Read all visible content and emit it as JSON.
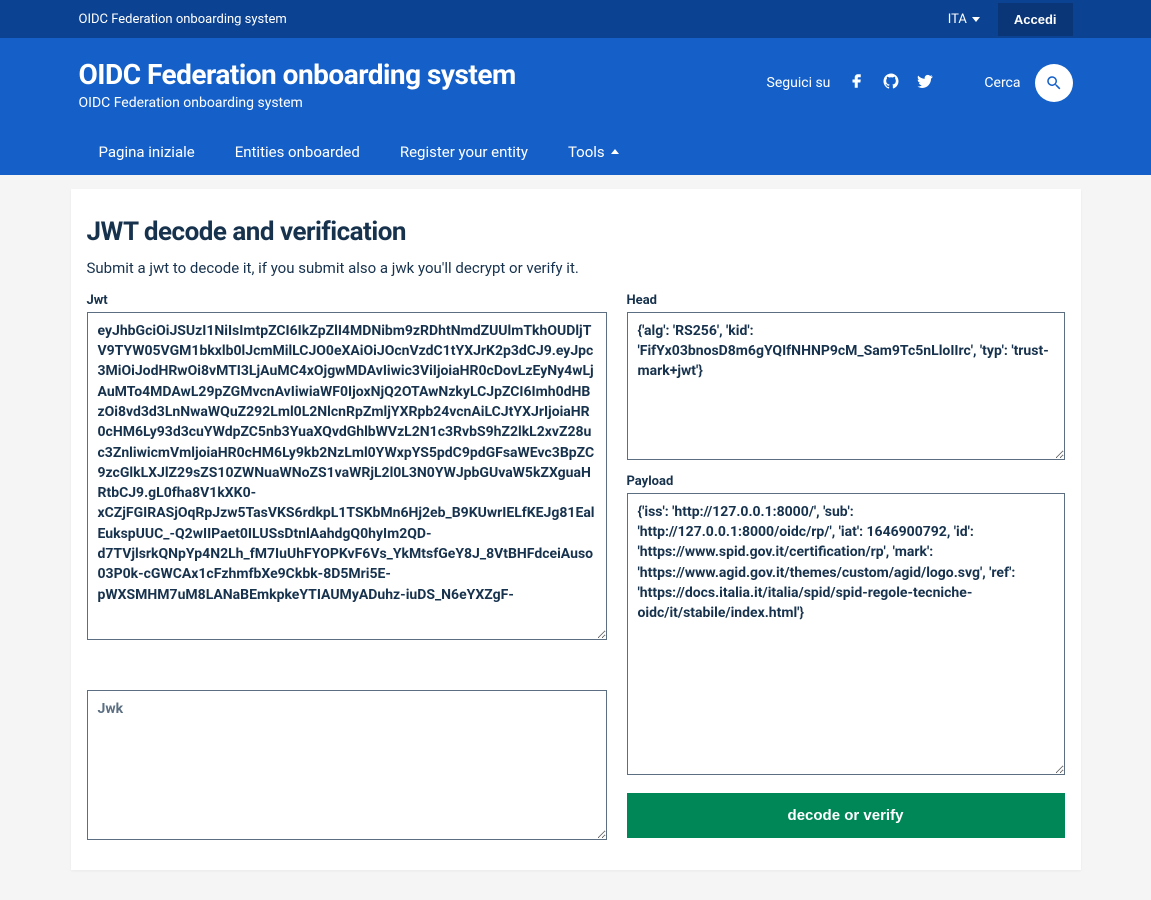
{
  "topbar": {
    "site_name": "OIDC Federation onboarding system",
    "language": "ITA",
    "login": "Accedi"
  },
  "header": {
    "title": "OIDC Federation onboarding system",
    "subtitle": "OIDC Federation onboarding system",
    "follow": "Seguici su",
    "search": "Cerca"
  },
  "nav": {
    "home": "Pagina iniziale",
    "entities": "Entities onboarded",
    "register": "Register your entity",
    "tools": "Tools"
  },
  "page": {
    "heading": "JWT decode and verification",
    "intro": "Submit a jwt to decode it, if you submit also a jwk you'll decrypt or verify it."
  },
  "form": {
    "jwt_label": "Jwt",
    "jwt_value": "eyJhbGciOiJSUzI1NiIsImtpZCI6IkZpZlI4MDNibm9zRDhtNmdZUUlmTkhOUDljTV9TYW05VGM1bkxlb0lJcmMilLCJO0eXAiOiJOcnVzdC1tYXJrK2p3dCJ9.eyJpc3MiOiJodHRwOi8vMTI3LjAuMC4xOjgwMDAvIiwic3ViIjoiaHR0cDovLzEyNy4wLjAuMTo4MDAwL29pZGMvcnAvIiwiaWF0IjoxNjQ2OTAwNzkyLCJpZCI6Imh0dHBzOi8vd3d3LnNwaWQuZ292Lml0L2NlcnRpZmljYXRpb24vcnAiLCJtYXJrIjoiaHR0cHM6Ly93d3cuYWdpZC5nb3YuaXQvdGhlbWVzL2N1c3RvbS9hZ2lkL2xvZ28uc3ZnliwicmVmljoiaHR0cHM6Ly9kb2NzLml0YWxpYS5pdC9pdGFsaWEvc3BpZC9zcGlkLXJlZ29sZS10ZWNuaWNoZS1vaWRjL2l0L3N0YWJpbGUvaW5kZXguaHRtbCJ9.gL0fha8V1kXK0-xCZjFGIRASjOqRpJzw5TasVKS6rdkpL1TSKbMn6Hj2eb_B9KUwrIELfKEJg81EalEukspUUC_-Q2wIIPaet0ILUSsDtnlAahdgQ0hyIm2QD-d7TVjlsrkQNpYp4N2Lh_fM7IuUhFYOPKvF6Vs_YkMtsfGeY8J_8VtBHFdceiAuso03P0k-cGWCAx1cFzhmfbXe9Ckbk-8D5Mri5E-pWXSMHM7uM8LANaBEmkpkeYTIAUMyADuhz-iuDS_N6eYXZgF-",
    "jwk_label": "Jwk",
    "jwk_placeholder": "Jwk",
    "head_label": "Head",
    "head_value": "{'alg': 'RS256', 'kid': 'FifYx03bnosD8m6gYQIfNHNP9cM_Sam9Tc5nLloIIrc', 'typ': 'trust-mark+jwt'}",
    "payload_label": "Payload",
    "payload_value": "{'iss': 'http://127.0.0.1:8000/', 'sub': 'http://127.0.0.1:8000/oidc/rp/', 'iat': 1646900792, 'id': 'https://www.spid.gov.it/certification/rp', 'mark': 'https://www.agid.gov.it/themes/custom/agid/logo.svg', 'ref': 'https://docs.italia.it/italia/spid/spid-regole-tecniche-oidc/it/stabile/index.html'}",
    "submit": "decode or verify"
  }
}
